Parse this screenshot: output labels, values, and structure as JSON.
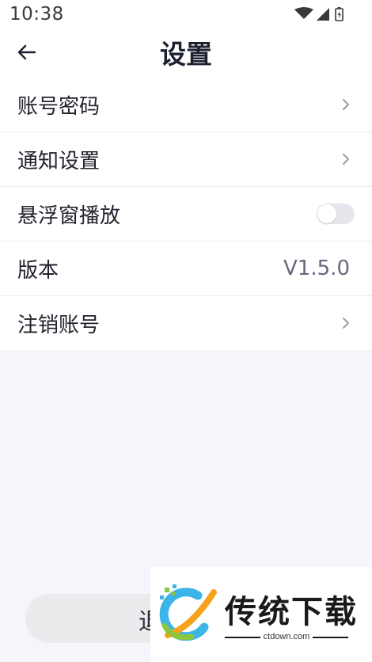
{
  "status_bar": {
    "time": "10:38"
  },
  "header": {
    "title": "设置"
  },
  "settings": {
    "items": [
      {
        "label": "账号密码",
        "control": "chevron"
      },
      {
        "label": "通知设置",
        "control": "chevron"
      },
      {
        "label": "悬浮窗播放",
        "control": "toggle",
        "enabled": false
      },
      {
        "label": "版本",
        "control": "value",
        "value": "V1.5.0"
      },
      {
        "label": "注销账号",
        "control": "chevron"
      }
    ]
  },
  "logout": {
    "label": "退出登录"
  },
  "watermark": {
    "name": "传统下载",
    "domain": "ctdown.com"
  },
  "colors": {
    "background": "#f5f6fb",
    "toggle_off": "#e6e7ec",
    "logout_button": "#ebebee"
  }
}
